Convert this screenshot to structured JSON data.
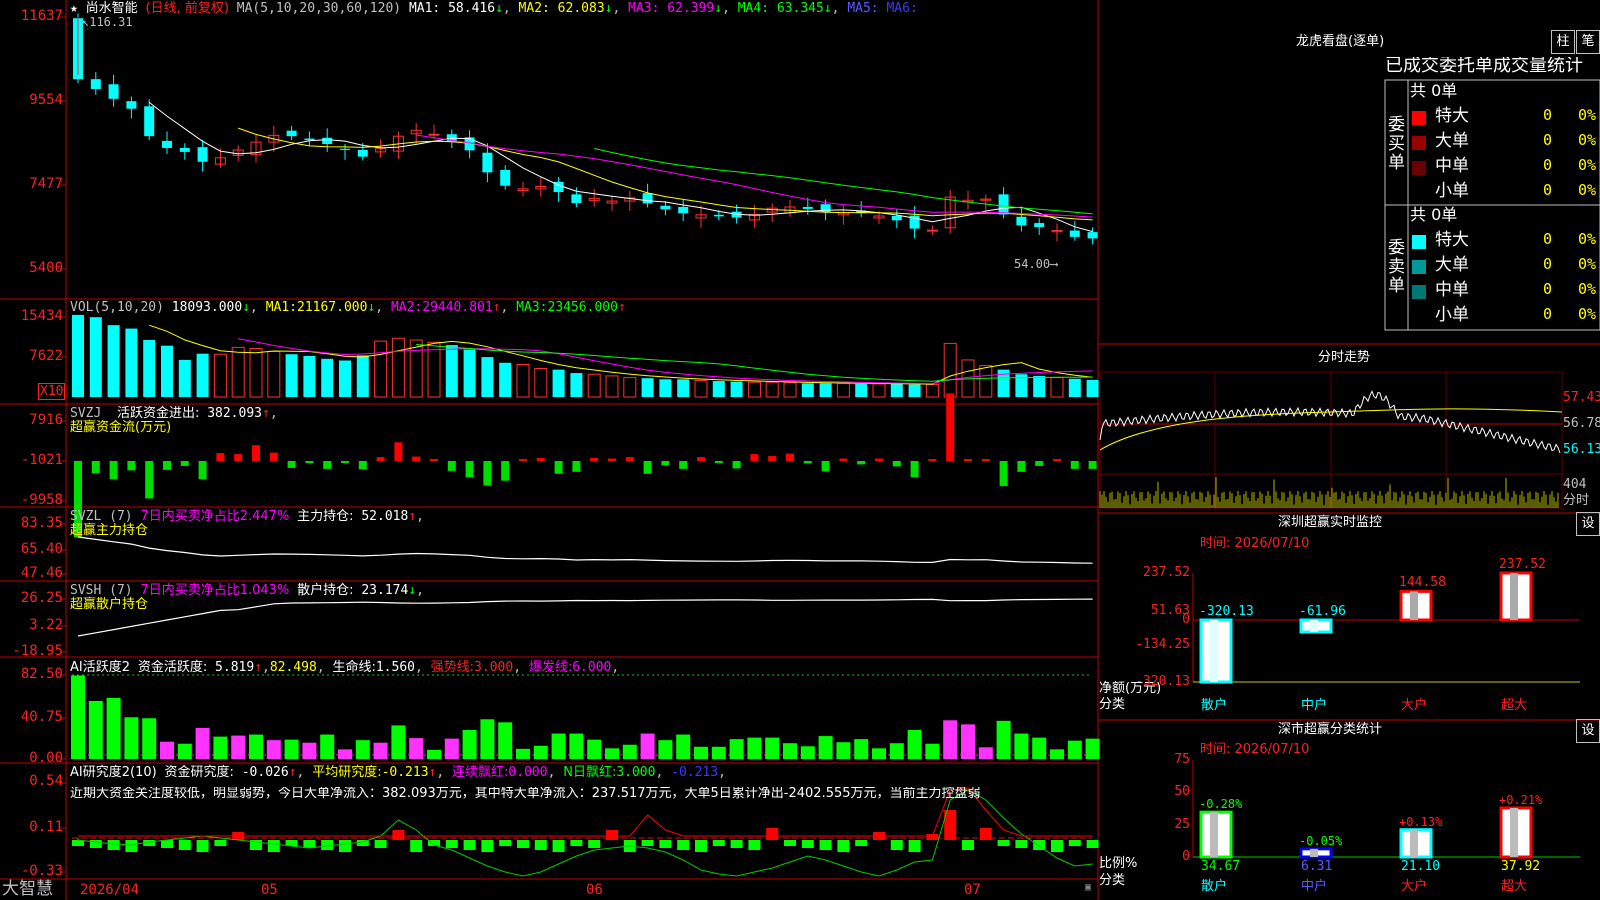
{
  "stock": {
    "star": "★",
    "name": "尚水智能",
    "period": "(日线, 前复权)",
    "ma_label": "MA(5,10,20,30,60,120)",
    "ma_values": [
      {
        "label": "MA1:",
        "value": "58.416",
        "arrow": "↓",
        "color": "#ffffff"
      },
      {
        "label": "MA2:",
        "value": "62.083",
        "arrow": "↓",
        "color": "#ffff00"
      },
      {
        "label": "MA3:",
        "value": "62.399",
        "arrow": "↓",
        "color": "#ff00ff"
      },
      {
        "label": "MA4:",
        "value": "63.345",
        "arrow": "↓",
        "color": "#00ff00"
      },
      {
        "label": "MA5:",
        "value": "",
        "arrow": "",
        "color": "#5a5aff"
      },
      {
        "label": "MA6:",
        "value": "",
        "arrow": "",
        "color": "#3a3aff"
      }
    ],
    "price_axis": [
      "11637",
      "9554",
      "7477",
      "5400"
    ],
    "high_label": "116.31",
    "low_label": "54.00",
    "low_arrow": "⟶",
    "bottom_brand": "大智慧",
    "dates": [
      "2026/04",
      "05",
      "06",
      "07"
    ]
  },
  "volume": {
    "title": "VOL(5,10,20)",
    "value": "18093.000",
    "value_arrow": "↓",
    "ma1_label": "MA1:",
    "ma1": "21167.000",
    "ma1_arrow": "↓",
    "ma2_label": "MA2:",
    "ma2": "29440.801",
    "ma2_arrow": "↑",
    "ma3_label": "MA3:",
    "ma3": "23456.000",
    "ma3_arrow": "↑",
    "axis": [
      "15434",
      "7622"
    ],
    "unit_badge": "X10"
  },
  "svzj": {
    "title": "SVZJ",
    "label": "活跃资金进出:",
    "value": "382.093",
    "arrow": "↑",
    "subtitle": "超赢资金流(万元)",
    "axis": [
      "7916",
      "-1021",
      "-9958"
    ]
  },
  "svzl": {
    "title": "SVZL (7)",
    "pct_label": "7日内买卖净占比2.447%",
    "hold_label": "主力持仓:",
    "hold_value": "52.018",
    "arrow": "↑",
    "subtitle": "超赢主力持仓",
    "axis": [
      "83.35",
      "65.40",
      "47.46"
    ]
  },
  "svsh": {
    "title": "SVSH (7)",
    "pct_label": "7日内买卖净占比1.043%",
    "hold_label": "散户持仓:",
    "hold_value": "23.174",
    "arrow": "↓",
    "subtitle": "超赢散户持仓",
    "axis": [
      "26.25",
      "3.22",
      "-18.95"
    ]
  },
  "ai_active": {
    "title": "AI活跃度2",
    "label": "资金活跃度:",
    "value": "5.819",
    "arrow": "↑",
    "v2": "82.498",
    "life_label": "生命线:",
    "life": "1.560",
    "strong_label": "强势线:",
    "strong": "3.000",
    "burst_label": "爆发线:",
    "burst": "6.000",
    "axis": [
      "82.50",
      "40.75",
      "0.00"
    ]
  },
  "ai_research": {
    "title": "AI研究度2(10)",
    "label": "资金研究度:",
    "value": "-0.026",
    "arrow": "↑",
    "avg_label": "平均研究度:",
    "avg": "-0.213",
    "avg_arrow": "↑",
    "red_label": "连续飘红:",
    "red": "0.000",
    "nred_label": "N日飘红:",
    "nred": "3.000",
    "last": "-0.213",
    "summary": "近期大资金关注度较低，明显弱势，今日大单净流入：382.093万元，其中特大单净流入：237.517万元，大单5日累计净出-2402.555万元，当前主力控盘弱",
    "axis": [
      "0.54",
      "0.11",
      "-0.33"
    ]
  },
  "dragon_tiger": {
    "title": "龙虎看盘(逐单)",
    "btn_bar": "柱",
    "btn_deal": "笔",
    "header": "已成交委托单成交量统计",
    "buy_label": "委买单",
    "sell_label": "委卖单",
    "buy_total": "共 0单",
    "sell_total": "共 0单",
    "buy_rows": [
      {
        "name": "特大",
        "count": "0",
        "pct": "0%",
        "color": "#ff0000"
      },
      {
        "name": "大单",
        "count": "0",
        "pct": "0%",
        "color": "#990000"
      },
      {
        "name": "中单",
        "count": "0",
        "pct": "0%",
        "color": "#6a0000"
      },
      {
        "name": "小单",
        "count": "0",
        "pct": "0%",
        "color": "#000000"
      }
    ],
    "sell_rows": [
      {
        "name": "特大",
        "count": "0",
        "pct": "0%",
        "color": "#00ffff"
      },
      {
        "name": "大单",
        "count": "0",
        "pct": "0%",
        "color": "#009999"
      },
      {
        "name": "中单",
        "count": "0",
        "pct": "0%",
        "color": "#007777"
      },
      {
        "name": "小单",
        "count": "0",
        "pct": "0%",
        "color": "#000000"
      }
    ]
  },
  "intraday": {
    "title": "分时走势",
    "price_axis": [
      "57.43",
      "56.78",
      "56.13"
    ],
    "vol_axis": "404",
    "vol_label": "分时"
  },
  "sz_monitor": {
    "title": "深圳超赢实时监控",
    "btn": "设",
    "time": "时间: 2026/07/10",
    "axis": [
      "237.52",
      "51.63",
      "0",
      "-134.25",
      "-320.13"
    ],
    "ylabel": "净额(万元)",
    "xlabel": "分类",
    "categories": [
      "散户",
      "中户",
      "大户",
      "超大"
    ],
    "value_labels": [
      "-320.13",
      "-61.96",
      "144.58",
      "237.52"
    ]
  },
  "sz_class": {
    "title": "深市超赢分类统计",
    "btn": "设",
    "time": "时间: 2026/07/10",
    "axis": [
      "75",
      "50",
      "25",
      "0"
    ],
    "ylabel": "比例%",
    "xlabel": "分类",
    "categories": [
      "散户",
      "中户",
      "大户",
      "超大"
    ],
    "change_labels": [
      "-0.28%",
      "-0.05%",
      "+0.13%",
      "+0.21%"
    ],
    "totals": [
      "34.67",
      "6.31",
      "21.10",
      "37.92"
    ]
  },
  "chart_data": [
    {
      "type": "bar",
      "title": "深圳超赢实时监控",
      "xlabel": "分类",
      "ylabel": "净额(万元)",
      "categories": [
        "散户",
        "中户",
        "大户",
        "超大"
      ],
      "values": [
        -320.13,
        -61.96,
        144.58,
        237.52
      ],
      "ylim": [
        -320.13,
        237.52
      ],
      "colors": [
        "#00ffff",
        "#00ffff",
        "#ff0000",
        "#ff0000"
      ]
    },
    {
      "type": "bar",
      "title": "深市超赢分类统计",
      "xlabel": "分类",
      "ylabel": "比例%",
      "categories": [
        "散户",
        "中户",
        "大户",
        "超大"
      ],
      "values": [
        34.67,
        6.31,
        21.1,
        37.92
      ],
      "changes": [
        -0.28,
        -0.05,
        0.13,
        0.21
      ],
      "ylim": [
        0,
        75
      ],
      "colors": [
        "#00ff00",
        "#0000ff",
        "#00ffff",
        "#ff0000"
      ]
    },
    {
      "type": "candlestick",
      "title": "尚水智能",
      "x_range": [
        "2026/04",
        "07"
      ],
      "ylim": [
        54.0,
        116.31
      ],
      "close": [
        100.5,
        98.0,
        95.5,
        93.0,
        86.0,
        83.0,
        82.0,
        79.5,
        80.5,
        82.5,
        84.5,
        86.2,
        86.0,
        85.0,
        84.0,
        82.5,
        80.8,
        82.8,
        86.0,
        87.5,
        86.5,
        84.5,
        82.4,
        76.8,
        73.4,
        72.6,
        73.2,
        71.8,
        69.0,
        70.2,
        69.5,
        70.3,
        68.9,
        67.4,
        66.4,
        66.0,
        65.6,
        65.3,
        66.1,
        67.7,
        68.0,
        67.5,
        66.6,
        66.5,
        66.4,
        65.7,
        64.6,
        62.5,
        62.1,
        70.5,
        69.7,
        70.0,
        66.1,
        63.3,
        62.9,
        62.0,
        60.4,
        60.0
      ],
      "volume": [
        14400,
        14000,
        12600,
        12000,
        10000,
        9000,
        6500,
        7600,
        7500,
        8700,
        8500,
        8000,
        7500,
        7200,
        6700,
        6400,
        7300,
        9800,
        10300,
        10000,
        9600,
        9100,
        8300,
        7000,
        6000,
        5700,
        5000,
        4800,
        4200,
        4000,
        3700,
        3400,
        3300,
        3100,
        3100,
        2900,
        2800,
        2700,
        2600,
        2600,
        2500,
        2400,
        2400,
        2400,
        2300,
        2300,
        2300,
        2200,
        2200,
        9400,
        6500,
        5500,
        4800,
        4000,
        3700,
        3400,
        3200,
        3000
      ]
    }
  ]
}
